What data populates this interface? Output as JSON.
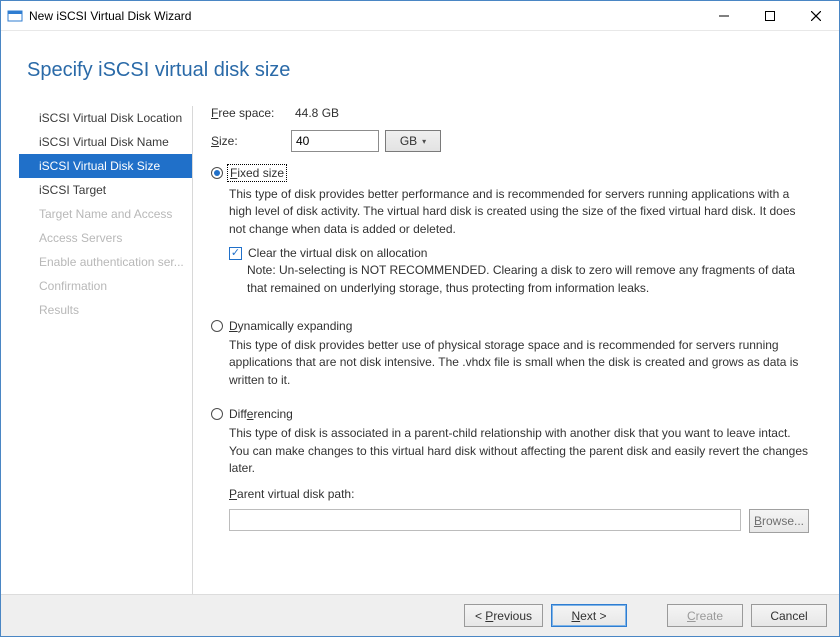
{
  "window": {
    "title": "New iSCSI Virtual Disk Wizard"
  },
  "heading": "Specify iSCSI virtual disk size",
  "nav": {
    "items": [
      {
        "label": "iSCSI Virtual Disk Location",
        "state": "enabled"
      },
      {
        "label": "iSCSI Virtual Disk Name",
        "state": "enabled"
      },
      {
        "label": "iSCSI Virtual Disk Size",
        "state": "active"
      },
      {
        "label": "iSCSI Target",
        "state": "enabled"
      },
      {
        "label": "Target Name and Access",
        "state": "disabled"
      },
      {
        "label": "Access Servers",
        "state": "disabled"
      },
      {
        "label": "Enable authentication ser...",
        "state": "disabled"
      },
      {
        "label": "Confirmation",
        "state": "disabled"
      },
      {
        "label": "Results",
        "state": "disabled"
      }
    ]
  },
  "form": {
    "free_space_label": "Free space:",
    "free_space_value": "44.8 GB",
    "size_label": "Size:",
    "size_value": "40",
    "size_unit": "GB",
    "options": {
      "fixed": {
        "label": "Fixed size",
        "desc": "This type of disk provides better performance and is recommended for servers running applications with a high level of disk activity. The virtual hard disk is created using the size of the fixed virtual hard disk. It does not change when data is added or deleted.",
        "clear_label": "Clear the virtual disk on allocation",
        "clear_checked": true,
        "note": "Note: Un-selecting is NOT RECOMMENDED. Clearing a disk to zero will remove any fragments of data that remained on underlying storage, thus protecting from information leaks."
      },
      "dynamic": {
        "label": "Dynamically expanding",
        "desc": "This type of disk provides better use of physical storage space and is recommended for servers running applications that are not disk intensive. The .vhdx file is small when the disk is created and grows as data is written to it."
      },
      "diff": {
        "label": "Differencing",
        "desc": "This type of disk is associated in a parent-child relationship with another disk that you want to leave intact. You can make changes to this virtual hard disk without affecting the parent disk and easily revert the changes later.",
        "parent_label": "Parent virtual disk path:",
        "browse_label": "Browse..."
      }
    },
    "selected_option": "fixed"
  },
  "footer": {
    "previous": "< Previous",
    "next": "Next >",
    "create": "Create",
    "cancel": "Cancel"
  }
}
